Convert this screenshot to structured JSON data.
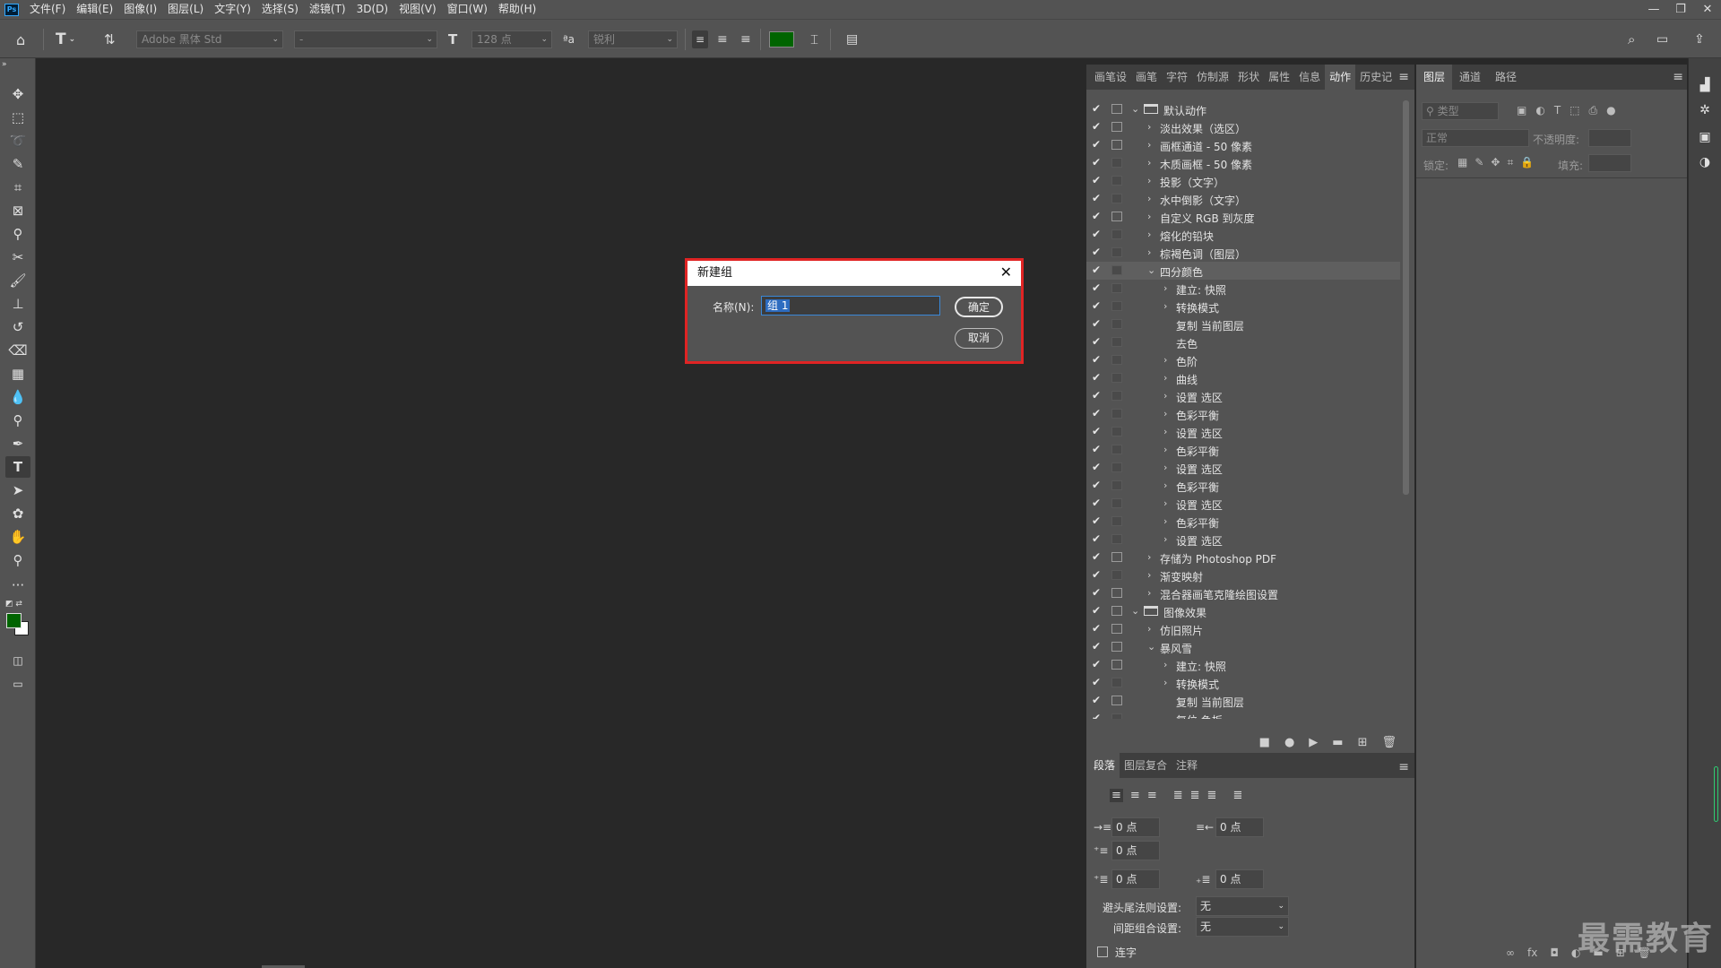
{
  "app": {
    "logo": "Ps"
  },
  "menu": [
    "文件(F)",
    "编辑(E)",
    "图像(I)",
    "图层(L)",
    "文字(Y)",
    "选择(S)",
    "滤镜(T)",
    "3D(D)",
    "视图(V)",
    "窗口(W)",
    "帮助(H)"
  ],
  "window_controls": {
    "minimize": "—",
    "restore": "❐",
    "close": "✕"
  },
  "options": {
    "font_family": "Adobe 黑体 Std",
    "font_style": "-",
    "font_size": "128 点",
    "antialias": "锐利",
    "text_color": "#006400"
  },
  "actions_panel": {
    "tabs": [
      "画笔设",
      "画笔",
      "字符",
      "仿制源",
      "形状",
      "属性",
      "信息",
      "动作",
      "历史记"
    ],
    "active_tab": "动作",
    "rows": [
      {
        "label": "默认动作",
        "level": 0,
        "folder": true,
        "expanded": true,
        "dialog": true
      },
      {
        "label": "淡出效果（选区）",
        "level": 1,
        "dialog": true
      },
      {
        "label": "画框通道 - 50 像素",
        "level": 1,
        "dialog": true
      },
      {
        "label": "木质画框 - 50 像素",
        "level": 1,
        "dialog": false
      },
      {
        "label": "投影（文字）",
        "level": 1,
        "dialog": false
      },
      {
        "label": "水中倒影（文字）",
        "level": 1,
        "dialog": false
      },
      {
        "label": "自定义 RGB 到灰度",
        "level": 1,
        "dialog": true
      },
      {
        "label": "熔化的铅块",
        "level": 1,
        "dialog": false
      },
      {
        "label": "棕褐色调（图层）",
        "level": 1,
        "dialog": false
      },
      {
        "label": "四分颜色",
        "level": 1,
        "expanded": true,
        "dialog": false,
        "highlight": true
      },
      {
        "label": "建立: 快照",
        "level": 2,
        "dialog": false
      },
      {
        "label": "转换模式",
        "level": 2,
        "dialog": false
      },
      {
        "label": "复制 当前图层",
        "level": 2,
        "noexp": true,
        "dialog": false
      },
      {
        "label": "去色",
        "level": 2,
        "noexp": true,
        "dialog": false
      },
      {
        "label": "色阶",
        "level": 2,
        "dialog": false
      },
      {
        "label": "曲线",
        "level": 2,
        "dialog": false
      },
      {
        "label": "设置 选区",
        "level": 2,
        "dialog": false
      },
      {
        "label": "色彩平衡",
        "level": 2,
        "dialog": false
      },
      {
        "label": "设置 选区",
        "level": 2,
        "dialog": false
      },
      {
        "label": "色彩平衡",
        "level": 2,
        "dialog": false
      },
      {
        "label": "设置 选区",
        "level": 2,
        "dialog": false
      },
      {
        "label": "色彩平衡",
        "level": 2,
        "dialog": false
      },
      {
        "label": "设置 选区",
        "level": 2,
        "dialog": false
      },
      {
        "label": "色彩平衡",
        "level": 2,
        "dialog": false
      },
      {
        "label": "设置 选区",
        "level": 2,
        "dialog": false
      },
      {
        "label": "存储为 Photoshop PDF",
        "level": 1,
        "dialog": true
      },
      {
        "label": "渐变映射",
        "level": 1,
        "dialog": false
      },
      {
        "label": "混合器画笔克隆绘图设置",
        "level": 1,
        "dialog": true
      },
      {
        "label": "图像效果",
        "level": 0,
        "folder": true,
        "expanded": true,
        "dialog": true
      },
      {
        "label": "仿旧照片",
        "level": 1,
        "dialog": true
      },
      {
        "label": "暴风雪",
        "level": 1,
        "expanded": true,
        "dialog": true
      },
      {
        "label": "建立: 快照",
        "level": 2,
        "dialog": true
      },
      {
        "label": "转换模式",
        "level": 2,
        "dialog": false
      },
      {
        "label": "复制 当前图层",
        "level": 2,
        "noexp": true,
        "dialog": true
      },
      {
        "label": "复位 色板",
        "level": 2,
        "noexp": true,
        "dialog": false
      }
    ],
    "footer_icons": [
      "stop-icon",
      "record-icon",
      "play-icon",
      "new-set-icon",
      "new-action-icon",
      "delete-icon"
    ]
  },
  "paragraph_panel": {
    "tabs": [
      "段落",
      "图层复合",
      "注释"
    ],
    "active_tab": "段落",
    "indent_left": "0 点",
    "indent_right": "0 点",
    "indent_first": "0 点",
    "space_before": "0 点",
    "space_after": "0 点",
    "kinsoku_label": "避头尾法则设置:",
    "kinsoku_value": "无",
    "mojikumi_label": "间距组合设置:",
    "mojikumi_value": "无",
    "hyphenate_label": "连字"
  },
  "layers_panel": {
    "tabs": [
      "图层",
      "通道",
      "路径"
    ],
    "active_tab": "图层",
    "filter_placeholder": "类型",
    "blend_mode": "正常",
    "opacity_label": "不透明度:",
    "lock_label": "锁定:",
    "fill_label": "填充:"
  },
  "dialog": {
    "title": "新建组",
    "name_label": "名称(N):",
    "name_value": "组 1",
    "ok_label": "确定",
    "cancel_label": "取消",
    "highlight_color": "#e02424"
  },
  "watermark": "最需教育"
}
